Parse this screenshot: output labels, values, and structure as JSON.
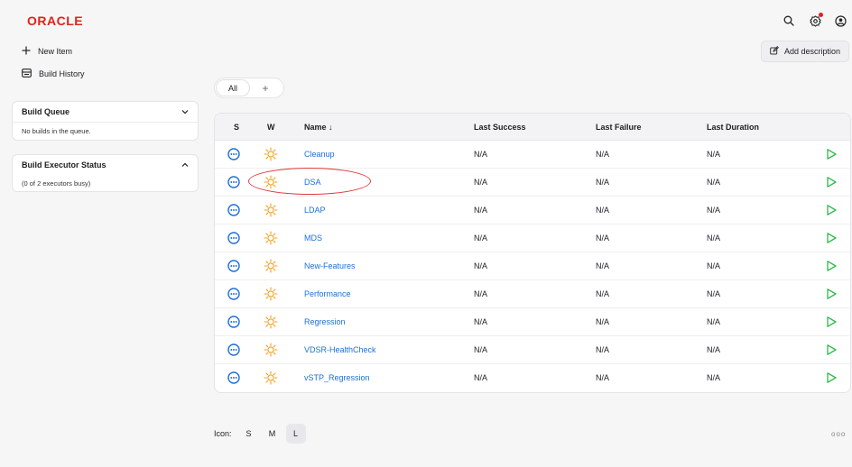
{
  "header": {
    "logo": "ORACLE",
    "icons": [
      "search-icon",
      "gear-icon",
      "user-icon"
    ]
  },
  "sidebar": {
    "new_item": "New Item",
    "build_history": "Build History",
    "build_queue": {
      "title": "Build Queue",
      "message": "No builds in the queue."
    },
    "executor_status": {
      "title": "Build Executor Status",
      "message": "(0 of 2 executors busy)"
    }
  },
  "add_description": "Add description",
  "tabs": {
    "all": "All",
    "add": "+"
  },
  "table": {
    "headers": {
      "s": "S",
      "w": "W",
      "name": "Name ↓",
      "last_success": "Last Success",
      "last_failure": "Last Failure",
      "last_duration": "Last Duration"
    },
    "rows": [
      {
        "name": "Cleanup",
        "last_success": "N/A",
        "last_failure": "N/A",
        "last_duration": "N/A"
      },
      {
        "name": "DSA",
        "last_success": "N/A",
        "last_failure": "N/A",
        "last_duration": "N/A"
      },
      {
        "name": "LDAP",
        "last_success": "N/A",
        "last_failure": "N/A",
        "last_duration": "N/A"
      },
      {
        "name": "MDS",
        "last_success": "N/A",
        "last_failure": "N/A",
        "last_duration": "N/A"
      },
      {
        "name": "New-Features",
        "last_success": "N/A",
        "last_failure": "N/A",
        "last_duration": "N/A"
      },
      {
        "name": "Performance",
        "last_success": "N/A",
        "last_failure": "N/A",
        "last_duration": "N/A"
      },
      {
        "name": "Regression",
        "last_success": "N/A",
        "last_failure": "N/A",
        "last_duration": "N/A"
      },
      {
        "name": "VDSR-HealthCheck",
        "last_success": "N/A",
        "last_failure": "N/A",
        "last_duration": "N/A"
      },
      {
        "name": "vSTP_Regression",
        "last_success": "N/A",
        "last_failure": "N/A",
        "last_duration": "N/A"
      }
    ]
  },
  "icon_size": {
    "label": "Icon:",
    "options": [
      "S",
      "M",
      "L"
    ],
    "selected": "L"
  },
  "more": "ooo",
  "colors": {
    "brand": "#e2231a",
    "link": "#1d6fd8",
    "status": "#1d6fd8",
    "weather": "#f0a01e",
    "run": "#2fb94b",
    "annotation": "#e03a3a"
  }
}
